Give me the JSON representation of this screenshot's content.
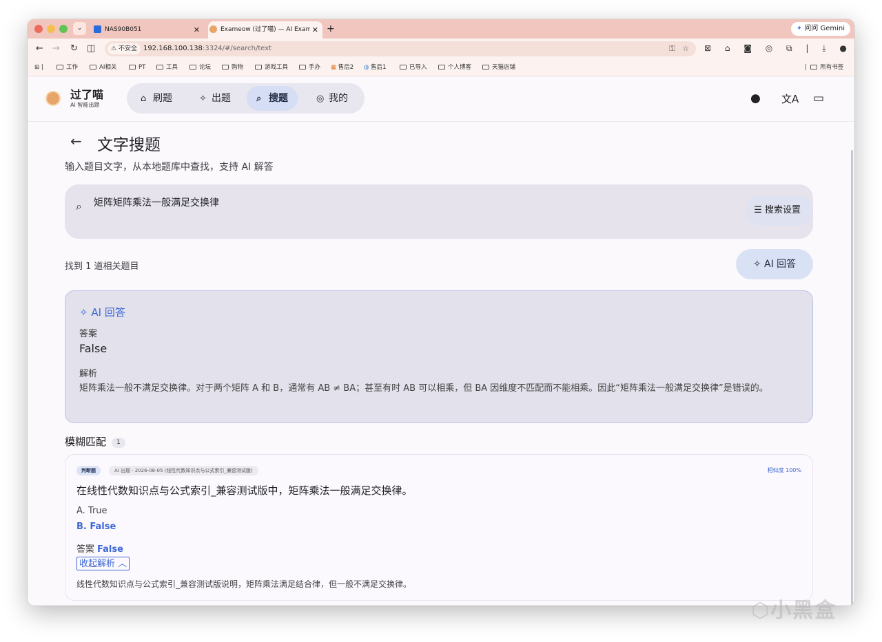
{
  "browser": {
    "tabs": [
      {
        "title": "NAS90B051",
        "active": false
      },
      {
        "title": "Exameow (过了喵) — AI Exam",
        "active": true
      }
    ],
    "gemini_label": "问问 Gemini",
    "url_insecure": "不安全",
    "url_host": "192.168.100.138",
    "url_rest": ":3324/#/search/text",
    "bookmarks": [
      "工作",
      "AI相关",
      "PT",
      "工具",
      "论坛",
      "购物",
      "游戏工具",
      "手办",
      "售后2",
      "售后1",
      "已导入",
      "个人博客",
      "天猫店铺"
    ],
    "all_bookmarks": "所有书签"
  },
  "app": {
    "brand_title": "过了喵",
    "brand_sub": "AI 智能出题",
    "nav": [
      {
        "label": "刷题",
        "icon": "graduation-cap-icon"
      },
      {
        "label": "出题",
        "icon": "sparkle-icon"
      },
      {
        "label": "搜题",
        "icon": "search-icon",
        "active": true
      },
      {
        "label": "我的",
        "icon": "user-icon"
      }
    ]
  },
  "page": {
    "title": "文字搜题",
    "subtitle": "输入题目文字，从本地题库中查找，支持 AI 解答",
    "search_value": "矩阵矩阵乘法一般满足交换律",
    "search_settings": "搜索设置",
    "found_text": "找到 1 道相关题目",
    "ai_button": "AI 回答"
  },
  "ai_answer": {
    "title": "AI 回答",
    "answer_label": "答案",
    "answer": "False",
    "explanation_label": "解析",
    "explanation": "矩阵乘法一般不满足交换律。对于两个矩阵 A 和 B，通常有 AB ≠ BA；甚至有时 AB 可以相乘，但 BA 因维度不匹配而不能相乘。因此“矩阵乘法一般满足交换律”是错误的。"
  },
  "fuzzy": {
    "title": "模糊匹配",
    "count": "1",
    "question": {
      "type": "判断题",
      "source": "AI 出题 · 2026-08-05 (线性代数知识点与公式索引_兼容测试版)",
      "similarity": "相似度 100%",
      "text": "在线性代数知识点与公式索引_兼容测试版中，矩阵乘法一般满足交换律。",
      "option_a": "A.  True",
      "option_b": "B.  False",
      "answer_label": "答案",
      "answer": "False",
      "collapse_label": "收起解析 ︿",
      "explanation": "线性代数知识点与公式索引_兼容测试版说明，矩阵乘法满足结合律，但一般不满足交换律。"
    }
  },
  "watermark": "小黑盒"
}
